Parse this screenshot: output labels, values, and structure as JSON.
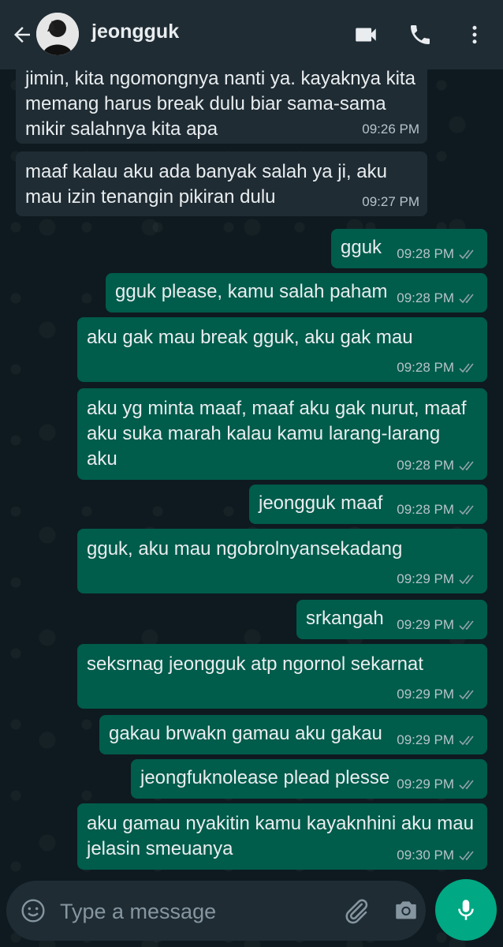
{
  "header": {
    "contact_name": "jeongguk",
    "icons": [
      "back-arrow-icon",
      "video-call-icon",
      "phone-icon",
      "more-vert-icon"
    ]
  },
  "messages": [
    {
      "dir": "in",
      "text": "jimin, kita ngomongnya nanti ya. kayaknya kita\nmemang harus break dulu biar sama-sama\nmikir salahnya kita apa",
      "time": "09:26 PM"
    },
    {
      "dir": "in",
      "text": "maaf kalau aku ada banyak salah ya ji, aku\nmau izin tenangin pikiran dulu",
      "time": "09:27 PM"
    },
    {
      "dir": "out",
      "text": "gguk",
      "time": "09:28 PM"
    },
    {
      "dir": "out",
      "text": "gguk please, kamu salah paham",
      "time": "09:28 PM"
    },
    {
      "dir": "out",
      "text": "aku gak mau break gguk, aku gak mau",
      "time": "09:28 PM"
    },
    {
      "dir": "out",
      "text": "aku yg minta maaf, maaf aku gak nurut, maaf\naku suka marah kalau kamu larang-larang\naku",
      "time": "09:28 PM"
    },
    {
      "dir": "out",
      "text": "jeongguk maaf",
      "time": "09:28 PM"
    },
    {
      "dir": "out",
      "text": "gguk, aku mau ngobrolnyansekadang",
      "time": "09:29 PM"
    },
    {
      "dir": "out",
      "text": "srkangah",
      "time": "09:29 PM"
    },
    {
      "dir": "out",
      "text": "seksrnag jeongguk atp ngornol sekarnat",
      "time": "09:29 PM"
    },
    {
      "dir": "out",
      "text": "gakau brwakn gamau aku gakau",
      "time": "09:29 PM"
    },
    {
      "dir": "out",
      "text": "jeongfuknolease plead plesse",
      "time": "09:29 PM"
    },
    {
      "dir": "out",
      "text": "aku gamau nyakitin kamu kayaknhini aku mau\njelasin smeuanya",
      "time": "09:30 PM"
    }
  ],
  "composer": {
    "placeholder": "Type a message"
  },
  "colors": {
    "header_bg": "#1f2c34",
    "incoming_bubble": "#1f2c34",
    "outgoing_bubble": "#005c4b",
    "accent": "#00a884"
  }
}
